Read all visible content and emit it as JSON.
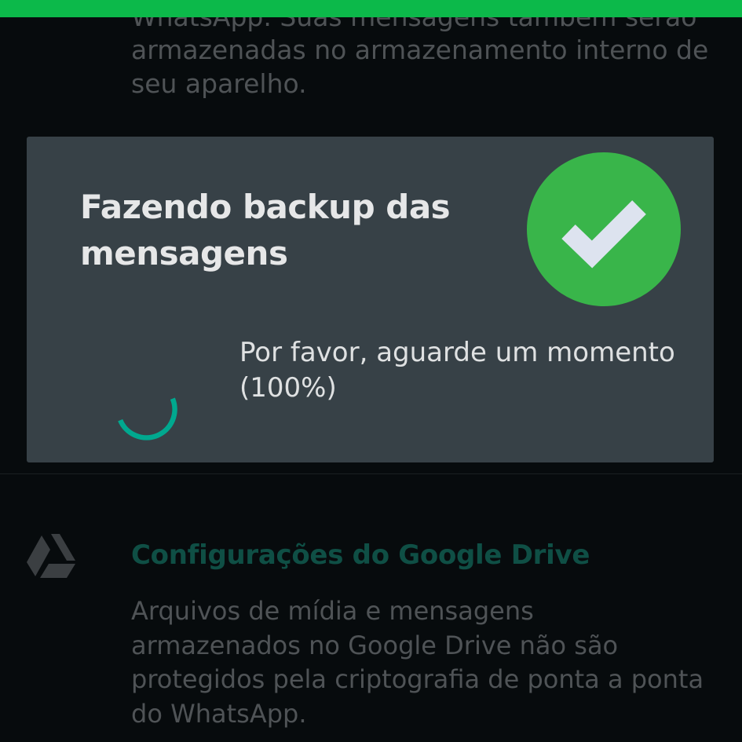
{
  "status_bar": {
    "color": "#0cb94a"
  },
  "background": {
    "top_text_lines": [
      "WhatsApp. Suas mensagens também serão",
      "armazenadas no armazenamento interno de",
      "seu aparelho."
    ],
    "google_drive": {
      "icon": "google-drive-icon",
      "title": "Configurações do Google Drive",
      "description_lines": [
        "Arquivos de mídia e mensagens",
        "armazenados no Google Drive não são",
        "protegidos pela criptografia de ponta a ponta",
        "do WhatsApp."
      ]
    }
  },
  "dialog": {
    "title": "Fazendo backup das mensagens",
    "icon": "check-circle-icon",
    "accent_color": "#39b54a",
    "spinner_color": "#00a88f",
    "message": "Por favor, aguarde um momento (100%)",
    "progress": 1.0
  }
}
